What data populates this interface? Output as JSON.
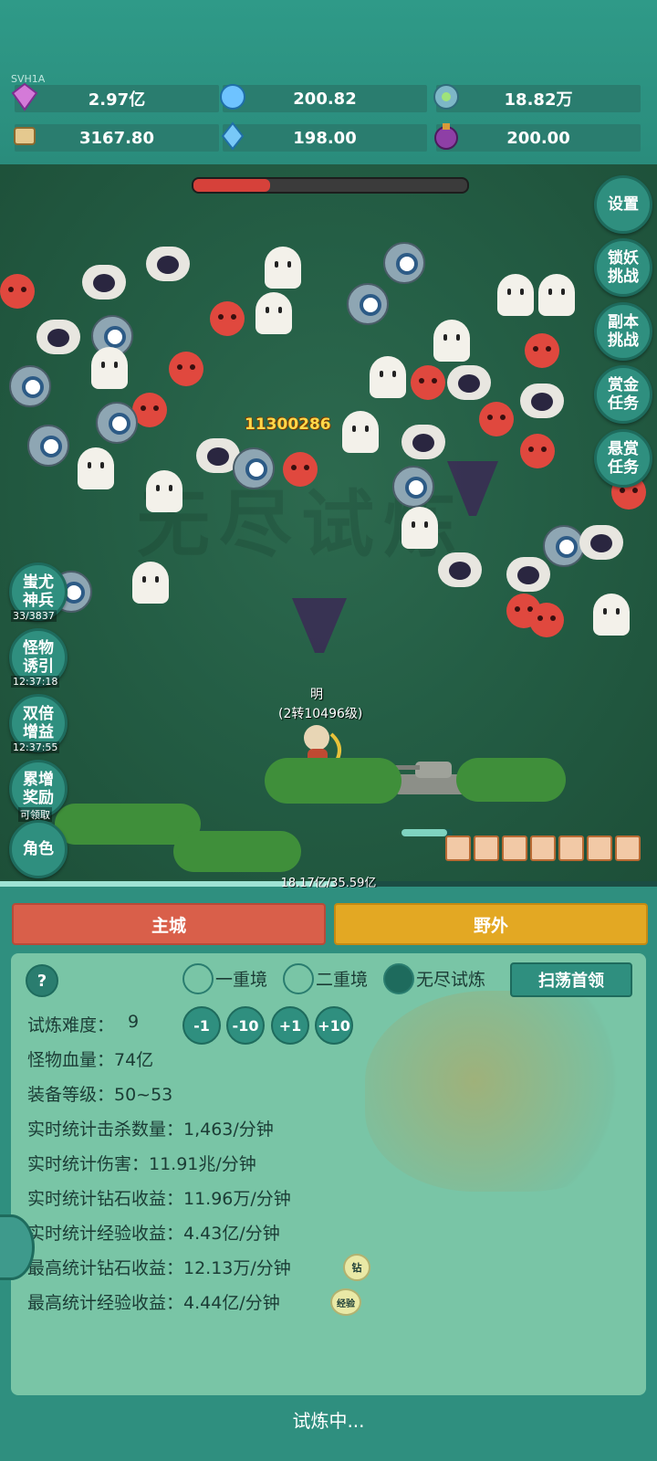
{
  "version": "SVH1A",
  "resources": [
    {
      "icon": "diamond-icon",
      "value": "2.97亿"
    },
    {
      "icon": "crystal-icon",
      "value": "200.82"
    },
    {
      "icon": "orb-icon",
      "value": "18.82万"
    },
    {
      "icon": "scroll-icon",
      "value": "3167.80"
    },
    {
      "icon": "shard-icon",
      "value": "198.00"
    },
    {
      "icon": "potion-icon",
      "value": "200.00"
    }
  ],
  "right_menu": {
    "settings": "设置",
    "lock_demon": "锁妖\n挑战",
    "dungeon": "副本\n挑战",
    "gold_task": "赏金\n任务",
    "bounty_task": "悬赏\n任务"
  },
  "left_menu": {
    "chiyou": "蚩尤\n神兵",
    "chiyou_sub": "33/3837",
    "lure": "怪物\n诱引",
    "lure_sub": "12:37:18",
    "double": "双倍\n增益",
    "double_sub": "12:37:55",
    "accum": "累增\n奖励",
    "accum_sub": "可领取",
    "role": "角色"
  },
  "battle": {
    "damage_number": "11300286",
    "hero_name": "明",
    "hero_level": "(2转10496级)",
    "watermark": "无尽试炼",
    "boss_hp_fraction": 0.28
  },
  "exp": {
    "text": "18.17亿/35.59亿",
    "fraction": 0.51
  },
  "tabs": {
    "city": "主城",
    "field": "野外"
  },
  "trial": {
    "help": "?",
    "modes": [
      "一重境",
      "二重境",
      "无尽试炼"
    ],
    "selected_mode": 2,
    "sweep": "扫荡首领",
    "difficulty_label": "试炼难度：",
    "difficulty_value": "9",
    "buttons": [
      "-1",
      "-10",
      "+1",
      "+10"
    ],
    "stats": [
      "怪物血量：74亿",
      "装备等级：50~53",
      "实时统计击杀数量：1,463/分钟",
      "实时统计伤害：11.91兆/分钟",
      "实时统计钻石收益：11.96万/分钟",
      "实时统计经验收益：4.43亿/分钟",
      "最高统计钻石收益：12.13万/分钟",
      "最高统计经验收益：4.44亿/分钟"
    ],
    "badge_diamond": "钻",
    "badge_exp": "经验",
    "status": "试炼中..."
  },
  "colors": {
    "red_tab": "#d95f4a",
    "yellow_tab": "#e3a823",
    "panel": "#79c5a6"
  }
}
